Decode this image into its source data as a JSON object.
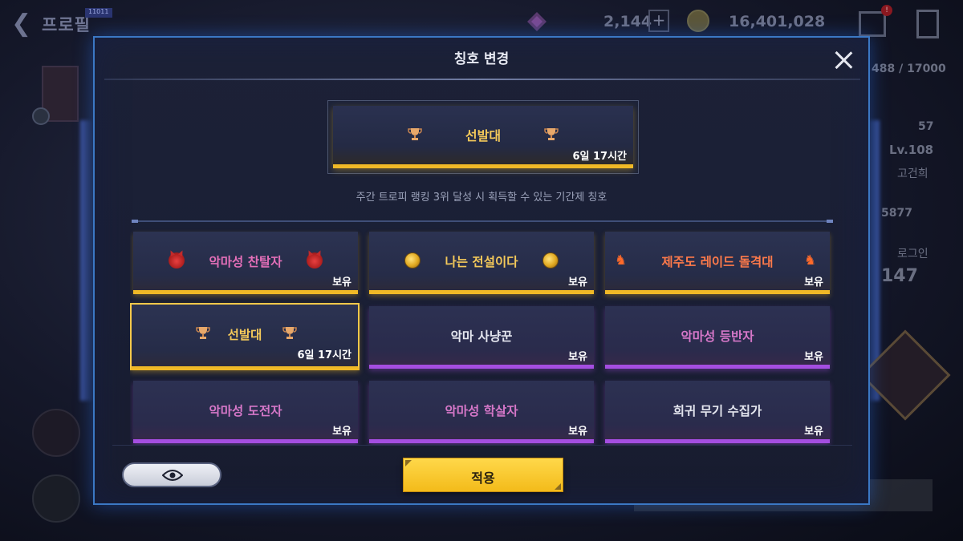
{
  "background": {
    "title": "프로필",
    "tag": "11011",
    "currency_1": "2,144",
    "currency_2": "16,401,028",
    "notification_badge": "!",
    "right_panel": {
      "exp": "488 / 17000",
      "power": "57",
      "level": "Lv.108",
      "name": "고건희",
      "search_value": "5877",
      "login_label": "로그인",
      "login_count": "147"
    }
  },
  "modal": {
    "title": "칭호 변경",
    "preview": {
      "label": "선발대",
      "time": "6일 17시간",
      "icon": "trophy-icon",
      "accent": "#f0b927"
    },
    "description": "주간 트로피 랭킹 3위 달성 시 획득할 수 있는 기간제 칭호",
    "titles": [
      {
        "name": "악마성 찬탈자",
        "status": "보유",
        "icon": "devil-icon",
        "tier": "gold",
        "color": "#e36fb8",
        "selected": false
      },
      {
        "name": "나는 전설이다",
        "status": "보유",
        "icon": "medal-icon",
        "tier": "gold",
        "color": "#f4c95a",
        "selected": false
      },
      {
        "name": "제주도 레이드 돌격대",
        "status": "보유",
        "icon": "horse-icon",
        "tier": "gold",
        "color": "#ff7a4a",
        "selected": false
      },
      {
        "name": "선발대",
        "status": "6일 17시간",
        "icon": "trophy-icon",
        "tier": "gold",
        "color": "#f4c95a",
        "selected": true
      },
      {
        "name": "악마 사냥꾼",
        "status": "보유",
        "icon": "",
        "tier": "purple",
        "color": "#e3e5ee",
        "selected": false
      },
      {
        "name": "악마성 등반자",
        "status": "보유",
        "icon": "",
        "tier": "purple",
        "color": "#d577c8",
        "selected": false
      },
      {
        "name": "악마성 도전자",
        "status": "보유",
        "icon": "",
        "tier": "purple",
        "color": "#d577c8",
        "selected": false
      },
      {
        "name": "악마성 학살자",
        "status": "보유",
        "icon": "",
        "tier": "purple",
        "color": "#d577c8",
        "selected": false
      },
      {
        "name": "희귀 무기 수집가",
        "status": "보유",
        "icon": "",
        "tier": "purple",
        "color": "#e3e5ee",
        "selected": false
      }
    ],
    "eye_button_icon": "eye-icon",
    "apply_label": "적용"
  },
  "colors": {
    "gold": "#f0b927",
    "purple": "#a44ee0",
    "frame_blue": "#3b78c4"
  }
}
